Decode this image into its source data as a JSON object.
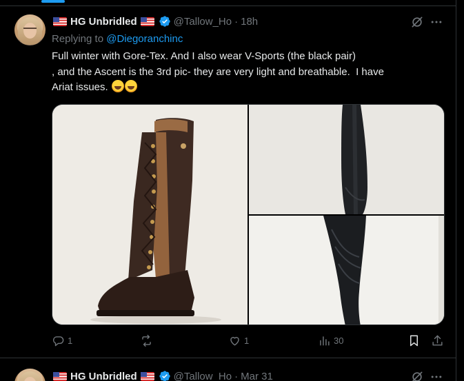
{
  "tweet1": {
    "name": "HG Unbridled",
    "handle": "@Tallow_Ho",
    "dot": "·",
    "time": "18h",
    "replying_to_prefix": "Replying to ",
    "replying_to_mention": "@Diegoranchinc",
    "text_lines": [
      "Full winter with Gore-Tex. And I also wear V-Sports (the black pair)",
      ", and the Ascent is the 3rd pic- they are very light and breathable.  I have",
      "Ariat issues. "
    ],
    "replies": "1",
    "likes": "1",
    "views": "30"
  },
  "tweet2": {
    "name": "HG Unbridled",
    "handle": "@Tallow_Ho",
    "dot": "·",
    "time": "Mar 31"
  },
  "colors": {
    "accent": "#1d9bf0",
    "muted": "#71767b",
    "text": "#e7e9ea",
    "background": "#000000",
    "divider": "#2f3336"
  },
  "icons": {
    "verified": "verified-badge-icon",
    "grok": "grok-icon",
    "more": "more-icon",
    "reply": "reply-icon",
    "repost": "repost-icon",
    "like": "like-icon",
    "views": "views-icon",
    "bookmark": "bookmark-icon",
    "share": "share-icon"
  }
}
